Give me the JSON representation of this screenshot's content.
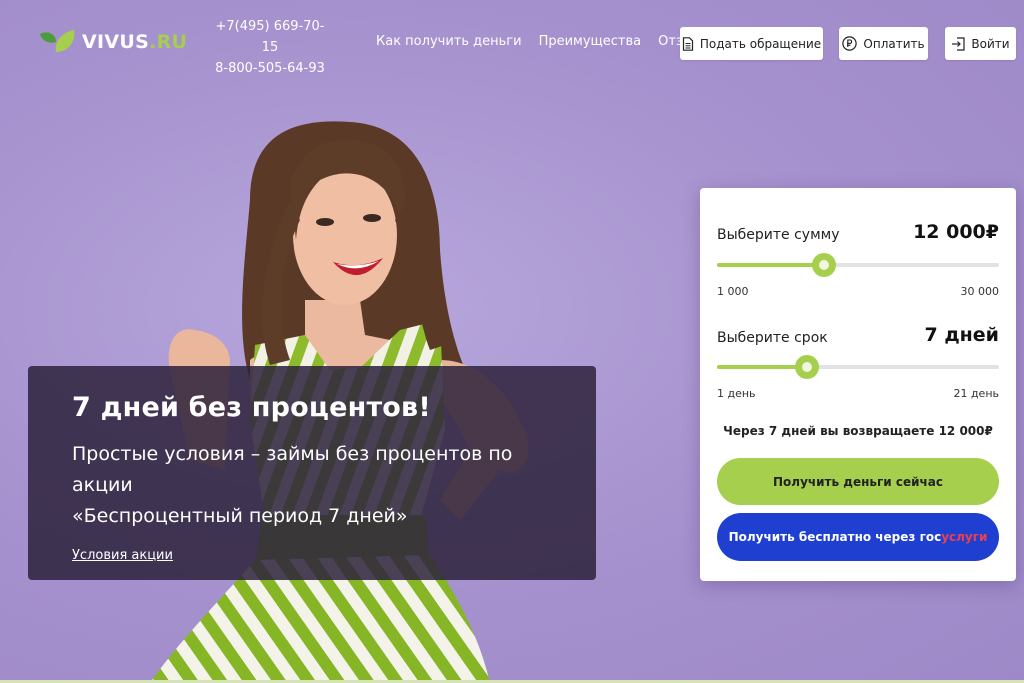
{
  "brand": {
    "name": "VIVUS",
    "domain": ".RU",
    "accent": "#a5cf4c",
    "background": "#a995cf",
    "gosuslugi_blue": "#1f3fd1",
    "gosuslugi_red": "#ee3f4c"
  },
  "header": {
    "phones": [
      "+7(495) 669-70-15",
      "8-800-505-64-93"
    ],
    "nav": [
      "Как получить деньги",
      "Преимущества",
      "Отзывы"
    ],
    "buttons": {
      "appeal": {
        "label": "Подать обращение",
        "icon": "document-icon"
      },
      "pay": {
        "label": "Оплатить",
        "icon": "ruble-coin-icon"
      },
      "login": {
        "label": "Войти",
        "icon": "login-icon"
      }
    }
  },
  "promo": {
    "title": "7 дней без процентов!",
    "text_line1": "Простые условия – займы без процентов по акции",
    "text_line2": "«Беспроцентный период 7 дней»",
    "link": "Условия акции"
  },
  "calculator": {
    "amount": {
      "label": "Выберите сумму",
      "value": "12 000₽",
      "min_label": "1 000",
      "max_label": "30 000",
      "fraction": 0.38
    },
    "term": {
      "label": "Выберите срок",
      "value": "7 дней",
      "min_label": "1 день",
      "max_label": "21 день",
      "fraction": 0.32
    },
    "summary": "Через 7 дней вы возвращаете 12 000₽",
    "primary_button": "Получить деньги сейчас",
    "gos_button_prefix": "Получить бесплатно через ",
    "gos_button_gos": "гос",
    "gos_button_uslugi": "услуги"
  }
}
